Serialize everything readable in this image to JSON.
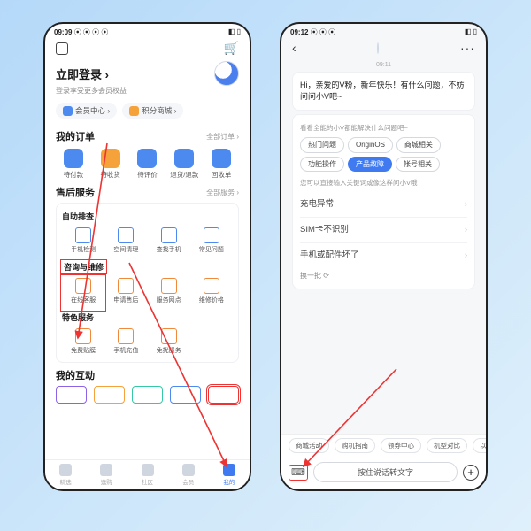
{
  "left": {
    "status_time": "09:09",
    "status_icons": "⦿ ⦿ ⦿ ⦿",
    "status_right": "◧ ▯",
    "login_title": "立即登录 ›",
    "login_sub": "登录享受更多会员权益",
    "pill_member": "会员中心 ›",
    "pill_mall": "积分商城 ›",
    "orders_title": "我的订单",
    "orders_more": "全部订单 ›",
    "orders": [
      {
        "label": "待付款",
        "color": "#4d8af0"
      },
      {
        "label": "待收货",
        "color": "#f5a23b"
      },
      {
        "label": "待评价",
        "color": "#4d8af0"
      },
      {
        "label": "退货/退款",
        "color": "#4d8af0"
      },
      {
        "label": "回收单",
        "color": "#4d8af0"
      }
    ],
    "after_title": "售后服务",
    "after_more": "全部服务 ›",
    "g1_title": "自助排查",
    "g1": [
      "手机检测",
      "空间清理",
      "查找手机",
      "常见问题"
    ],
    "g2_title": "咨询与维修",
    "g2": [
      "在线客服",
      "申请售后",
      "服务网点",
      "维修价格"
    ],
    "g3_title": "特色服务",
    "g3": [
      "免费贴膜",
      "手机充值",
      "免扰服务"
    ],
    "interact_title": "我的互动",
    "chip_colors": [
      "#8c63e6",
      "#f5a23b",
      "#36c9a6",
      "#4d8af0",
      "#e33"
    ],
    "nav": [
      {
        "label": "精选",
        "color": "#cfd6e0"
      },
      {
        "label": "选购",
        "color": "#cfd6e0"
      },
      {
        "label": "社区",
        "color": "#cfd6e0"
      },
      {
        "label": "会员",
        "color": "#cfd6e0"
      },
      {
        "label": "我的",
        "color": "#3f7af0"
      }
    ]
  },
  "right": {
    "status_time": "09:12",
    "status_icons": "⦿ ⦿ ⦿",
    "status_right": "◧ ▯",
    "time_stamp": "09:11",
    "greeting": "Hi，亲爱的V粉，新年快乐！有什么问题，不妨问问小V吧~",
    "cap1": "看看全能的小V都能解决什么问题吧~",
    "tags": [
      "热门问题",
      "OriginOS",
      "商城相关",
      "功能操作",
      "产品故障",
      "帐号相关"
    ],
    "active_tag_index": 4,
    "cap2": "您可以直接输入关键词或像这样问小V哦",
    "faq": [
      "充电异常",
      "SIM卡不识别",
      "手机或配件坏了"
    ],
    "refresh": "换一批 ⟳",
    "bottom_tabs": [
      "商城活动",
      "购机指南",
      "领券中心",
      "机型对比",
      "以"
    ],
    "voice_placeholder": "按住说话转文字"
  }
}
